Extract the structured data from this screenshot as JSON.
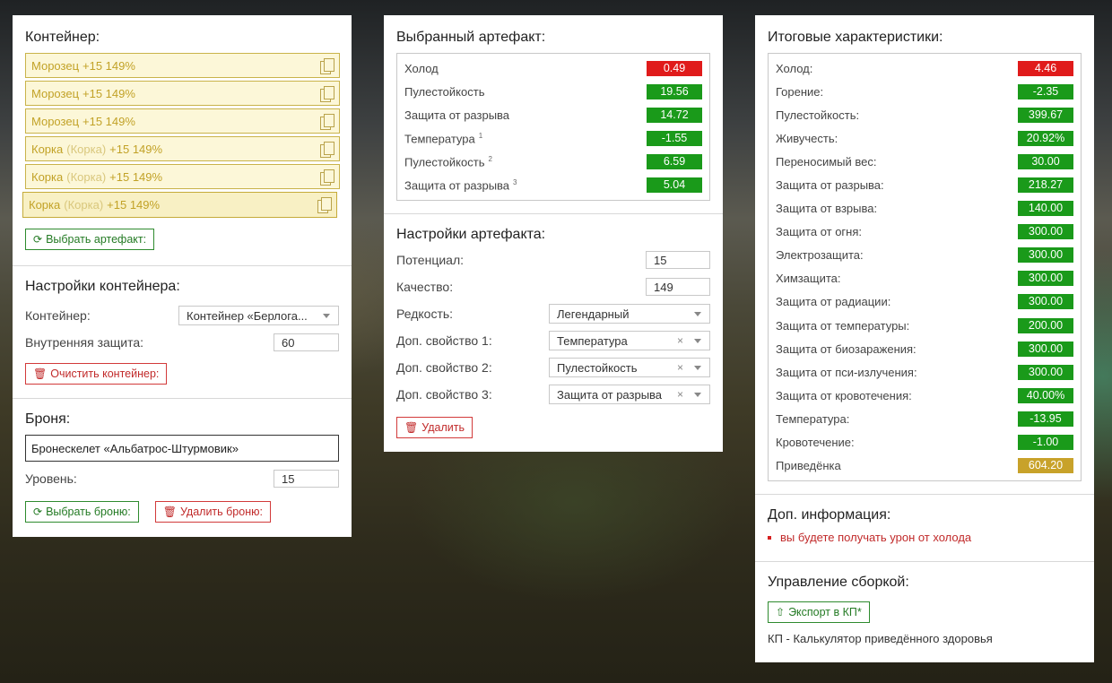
{
  "left": {
    "container": {
      "title": "Контейнер:",
      "items": [
        {
          "name": "Морозец",
          "sub": "",
          "stats": "+15 149%"
        },
        {
          "name": "Морозец",
          "sub": "",
          "stats": "+15 149%"
        },
        {
          "name": "Морозец",
          "sub": "",
          "stats": "+15 149%"
        },
        {
          "name": "Корка",
          "sub": "(Корка)",
          "stats": "+15 149%"
        },
        {
          "name": "Корка",
          "sub": "(Корка)",
          "stats": "+15 149%"
        },
        {
          "name": "Корка",
          "sub": "(Корка)",
          "stats": "+15 149%"
        }
      ],
      "select_button": "Выбрать артефакт:"
    },
    "container_settings": {
      "title": "Настройки контейнера:",
      "container_label": "Контейнер:",
      "container_value": "Контейнер «Берлога...",
      "inner_label": "Внутренняя защита:",
      "inner_value": "60",
      "clear_button": "Очистить контейнер:"
    },
    "armor": {
      "title": "Броня:",
      "name": "Бронескелет «Альбатрос-Штурмовик»",
      "level_label": "Уровень:",
      "level_value": "15",
      "select_button": "Выбрать броню:",
      "delete_button": "Удалить броню:"
    }
  },
  "middle": {
    "selected": {
      "title": "Выбранный артефакт:",
      "stats": [
        {
          "label": "Холод",
          "sup": "",
          "value": "0.49",
          "color": "red"
        },
        {
          "label": "Пулестойкость",
          "sup": "",
          "value": "19.56",
          "color": "green"
        },
        {
          "label": "Защита от разрыва",
          "sup": "",
          "value": "14.72",
          "color": "green"
        },
        {
          "label": "Температура",
          "sup": "1",
          "value": "-1.55",
          "color": "green"
        },
        {
          "label": "Пулестойкость",
          "sup": "2",
          "value": "6.59",
          "color": "green"
        },
        {
          "label": "Защита от разрыва",
          "sup": "3",
          "value": "5.04",
          "color": "green"
        }
      ]
    },
    "settings": {
      "title": "Настройки артефакта:",
      "potential_label": "Потенциал:",
      "potential_value": "15",
      "quality_label": "Качество:",
      "quality_value": "149",
      "rarity_label": "Редкость:",
      "rarity_value": "Легендарный",
      "prop1_label": "Доп. свойство 1:",
      "prop1_value": "Температура",
      "prop2_label": "Доп. свойство 2:",
      "prop2_value": "Пулестойкость",
      "prop3_label": "Доп. свойство 3:",
      "prop3_value": "Защита от разрыва",
      "clear_mark": "×",
      "delete_button": "Удалить"
    }
  },
  "right": {
    "totals": {
      "title": "Итоговые характеристики:",
      "stats": [
        {
          "label": "Холод:",
          "value": "4.46",
          "color": "red"
        },
        {
          "label": "Горение:",
          "value": "-2.35",
          "color": "green"
        },
        {
          "label": "Пулестойкость:",
          "value": "399.67",
          "color": "green"
        },
        {
          "label": "Живучесть:",
          "value": "20.92%",
          "color": "green"
        },
        {
          "label": "Переносимый вес:",
          "value": "30.00",
          "color": "green"
        },
        {
          "label": "Защита от разрыва:",
          "value": "218.27",
          "color": "green"
        },
        {
          "label": "Защита от взрыва:",
          "value": "140.00",
          "color": "green"
        },
        {
          "label": "Защита от огня:",
          "value": "300.00",
          "color": "green"
        },
        {
          "label": "Электрозащита:",
          "value": "300.00",
          "color": "green"
        },
        {
          "label": "Химзащита:",
          "value": "300.00",
          "color": "green"
        },
        {
          "label": "Защита от радиации:",
          "value": "300.00",
          "color": "green"
        },
        {
          "label": "Защита от температуры:",
          "value": "200.00",
          "color": "green"
        },
        {
          "label": "Защита от биозаражения:",
          "value": "300.00",
          "color": "green"
        },
        {
          "label": "Защита от пси-излучения:",
          "value": "300.00",
          "color": "green"
        },
        {
          "label": "Защита от кровотечения:",
          "value": "40.00%",
          "color": "green"
        },
        {
          "label": "Температура:",
          "value": "-13.95",
          "color": "green"
        },
        {
          "label": "Кровотечение:",
          "value": "-1.00",
          "color": "green"
        },
        {
          "label": "Приведёнка",
          "value": "604.20",
          "color": "gold"
        }
      ]
    },
    "info": {
      "title": "Доп. информация:",
      "items": [
        "вы будете получать урон от холода"
      ]
    },
    "build": {
      "title": "Управление сборкой:",
      "export_button": "Экспорт в КП*",
      "note": "КП - Калькулятор приведённого здоровья"
    }
  }
}
